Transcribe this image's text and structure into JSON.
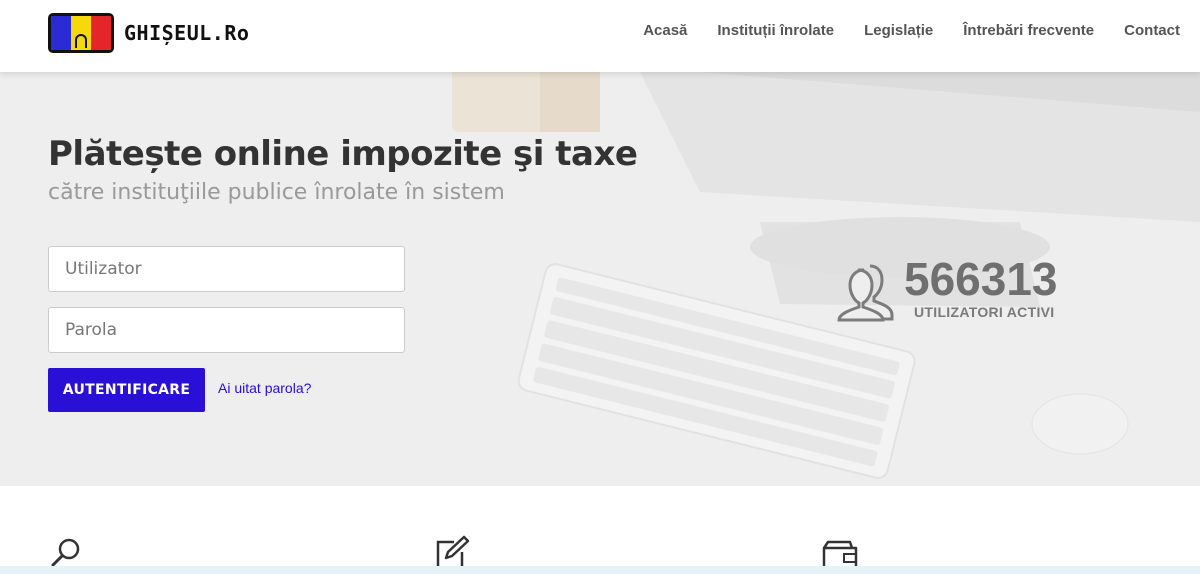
{
  "header": {
    "logo_text": "GHIȘEUL.Ro",
    "nav": [
      {
        "label": "Acasă"
      },
      {
        "label": "Instituții înrolate"
      },
      {
        "label": "Legislație"
      },
      {
        "label": "Întrebări frecvente"
      },
      {
        "label": "Contact"
      }
    ]
  },
  "hero": {
    "title": "Plătește online impozite şi taxe",
    "subtitle": "către instituţiile publice înrolate în sistem",
    "login": {
      "username_placeholder": "Utilizator",
      "password_placeholder": "Parola",
      "submit_label": "AUTENTIFICARE",
      "forgot_label": "Ai uitat parola?"
    },
    "stats": {
      "count": "566313",
      "label": "UTILIZATORI ACTIVI"
    }
  },
  "features": {
    "icons": [
      "search-icon",
      "edit-icon",
      "wallet-icon"
    ]
  },
  "colors": {
    "primary": "#2a0fd6",
    "flag_blue": "#2b2bd6",
    "flag_yellow": "#f5d90a",
    "flag_red": "#e4262a"
  }
}
